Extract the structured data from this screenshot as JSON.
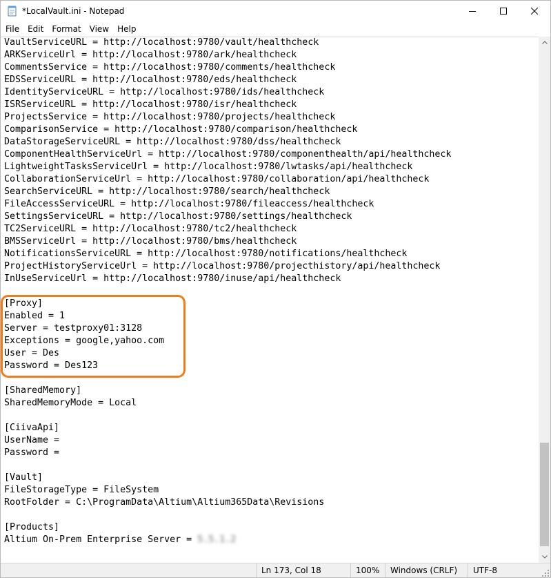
{
  "window": {
    "title": "*LocalVault.ini - Notepad",
    "icon": "notepad-icon",
    "controls": [
      "minimize-icon",
      "maximize-icon",
      "close-icon"
    ]
  },
  "menu": [
    "File",
    "Edit",
    "Format",
    "View",
    "Help"
  ],
  "editor": {
    "lines": [
      "VaultServiceURL = http://localhost:9780/vault/healthcheck",
      "ARKServiceUrl = http://localhost:9780/ark/healthcheck",
      "CommentsService = http://localhost:9780/comments/healthcheck",
      "EDSServiceURL = http://localhost:9780/eds/healthcheck",
      "IdentityServiceURL = http://localhost:9780/ids/healthcheck",
      "ISRServiceURL = http://localhost:9780/isr/healthcheck",
      "ProjectsService = http://localhost:9780/projects/healthcheck",
      "ComparisonService = http://localhost:9780/comparison/healthcheck",
      "DataStorageServiceURL = http://localhost:9780/dss/healthcheck",
      "ComponentHealthServiceUrl = http://localhost:9780/componenthealth/api/healthcheck",
      "LightweightTasksServiceUrl = http://localhost:9780/lwtasks/api/healthcheck",
      "CollaborationServiceUrl = http://localhost:9780/collaboration/api/healthcheck",
      "SearchServiceURL = http://localhost:9780/search/healthcheck",
      "FileAccessServiceURL = http://localhost:9780/fileaccess/healthcheck",
      "SettingsServiceURL = http://localhost:9780/settings/healthcheck",
      "TC2ServiceURL = http://localhost:9780/tc2/healthcheck",
      "BMSServiceUrl = http://localhost:9780/bms/healthcheck",
      "NotificationsServiceURL = http://localhost:9780/notifications/healthcheck",
      "ProjectHistoryServiceUrl = http://localhost:9780/projecthistory/api/healthcheck",
      "InUseServiceUrl = http://localhost:9780/inuse/api/healthcheck",
      "",
      "[Proxy]",
      "Enabled = 1",
      "Server = testproxy01:3128",
      "Exceptions = google,yahoo.com",
      "User = Des",
      "Password = Des123",
      "",
      "[SharedMemory]",
      "SharedMemoryMode = Local",
      "",
      "[CiivaApi]",
      "UserName = ",
      "Password = ",
      "",
      "[Vault]",
      "FileStorageType = FileSystem",
      "RootFolder = C:\\ProgramData\\Altium\\Altium365Data\\Revisions",
      "",
      "[Products]",
      "Altium On-Prem Enterprise Server = "
    ],
    "blurred_version": "5.5.1.2",
    "highlight_color": "#f07d1a"
  },
  "statusbar": {
    "position": "Ln 173, Col 18",
    "zoom": "100%",
    "line_ending": "Windows (CRLF)",
    "encoding": "UTF-8"
  }
}
